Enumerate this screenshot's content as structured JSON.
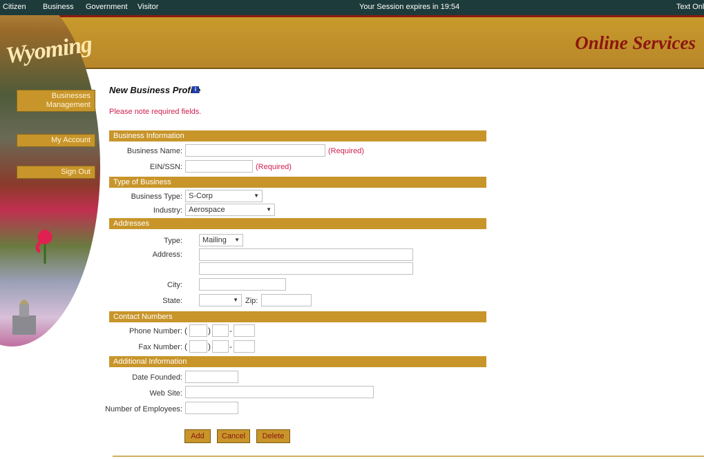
{
  "topbar": {
    "nav": [
      "Citizen",
      "Business",
      "Government",
      "Visitor"
    ],
    "session": "Your Session expires in 19:54",
    "text_only": "Text Onl"
  },
  "banner": {
    "logo": "Wyoming",
    "title": "Online Services"
  },
  "sidebar": {
    "businesses": "Businesses",
    "management": "Management",
    "my_account": "My Account",
    "sign_out": "Sign Out"
  },
  "page": {
    "title": "New Business Profile",
    "info_icon_label": "i",
    "note": "Please note required fields."
  },
  "sections": {
    "business_info": "Business Information",
    "type_of_business": "Type of Business",
    "addresses": "Addresses",
    "contact_numbers": "Contact Numbers",
    "additional_info": "Additional Information"
  },
  "fields": {
    "business_name": {
      "label": "Business Name:",
      "value": "",
      "required": "(Required)"
    },
    "ein_ssn": {
      "label": "EIN/SSN:",
      "value": "",
      "required": "(Required)"
    },
    "business_type": {
      "label": "Business Type:",
      "value": "S-Corp"
    },
    "industry": {
      "label": "Industry:",
      "value": "Aerospace"
    },
    "address_type": {
      "label": "Type:",
      "value": "Mailing"
    },
    "address": {
      "label": "Address:",
      "line1": "",
      "line2": ""
    },
    "city": {
      "label": "City:",
      "value": ""
    },
    "state": {
      "label": "State:",
      "value": ""
    },
    "zip": {
      "label": "Zip:",
      "value": ""
    },
    "phone": {
      "label": "Phone Number:",
      "open": "(",
      "close": ")",
      "dash": "-"
    },
    "fax": {
      "label": "Fax Number:",
      "open": "(",
      "close": ")",
      "dash": "-"
    },
    "date_founded": {
      "label": "Date Founded:",
      "value": ""
    },
    "web_site": {
      "label": "Web Site:",
      "value": ""
    },
    "employees": {
      "label": "Number of Employees:",
      "value": ""
    }
  },
  "buttons": {
    "add": "Add",
    "cancel": "Cancel",
    "delete": "Delete"
  },
  "colors": {
    "bar": "#1e3b3b",
    "gold": "#c8952a",
    "maroon": "#8c1510",
    "required": "#d02050"
  }
}
